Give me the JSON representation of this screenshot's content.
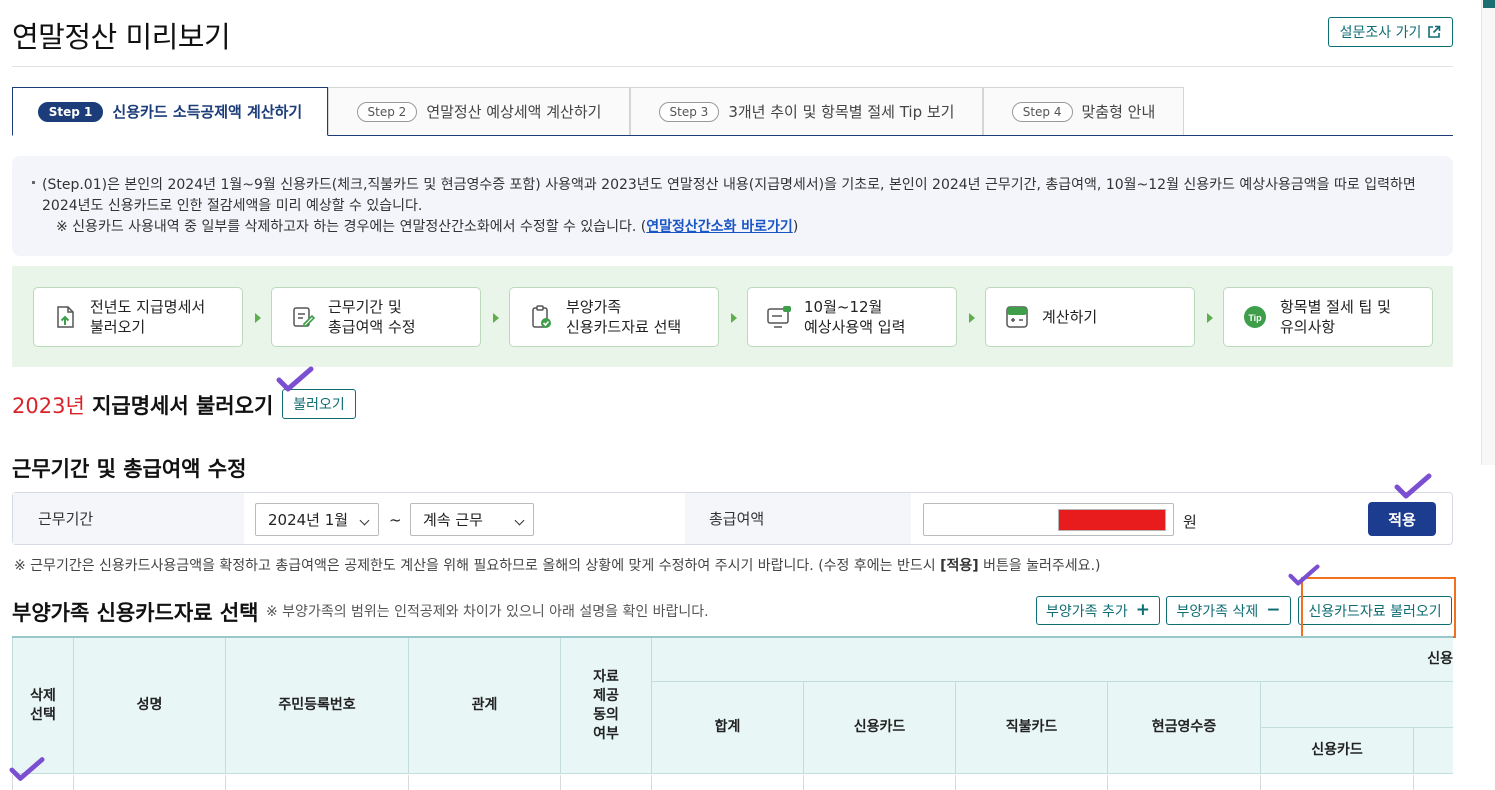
{
  "page": {
    "title": "연말정산 미리보기",
    "survey_button": "설문조사 가기"
  },
  "tabs": [
    {
      "step": "Step 1",
      "label": "신용카드 소득공제액 계산하기",
      "active": true
    },
    {
      "step": "Step 2",
      "label": "연말정산 예상세액 계산하기",
      "active": false
    },
    {
      "step": "Step 3",
      "label": "3개년 추이 및 항목별 절세 Tip 보기",
      "active": false
    },
    {
      "step": "Step 4",
      "label": "맞춤형 안내",
      "active": false
    }
  ],
  "notice": {
    "line1": "(Step.01)은 본인의 2024년 1월~9월 신용카드(체크,직불카드 및 현금영수증 포함) 사용액과 2023년도 연말정산 내용(지급명세서)을 기초로, 본인이 2024년 근무기간, 총급여액, 10월~12월 신용카드 예상사용금액을 따로 입력하면",
    "line2": "2024년도 신용카드로 인한 절감세액을 미리 예상할 수 있습니다.",
    "line3_prefix": "※ 신용카드 사용내역 중 일부를 삭제하고자 하는 경우에는 연말정산간소화에서 수정할 수 있습니다. (",
    "line3_link": "연말정산간소화 바로가기",
    "line3_suffix": ")"
  },
  "process": [
    {
      "icon": "document-upload-icon",
      "line1": "전년도 지급명세서",
      "line2": "불러오기"
    },
    {
      "icon": "edit-document-icon",
      "line1": "근무기간 및",
      "line2": "총급여액 수정"
    },
    {
      "icon": "clipboard-check-icon",
      "line1": "부양가족",
      "line2": "신용카드자료 선택"
    },
    {
      "icon": "card-input-icon",
      "line1": "10월~12월",
      "line2": "예상사용액 입력"
    },
    {
      "icon": "calculator-icon",
      "line1": "계산하기",
      "line2": ""
    },
    {
      "icon": "tip-icon",
      "line1": "항목별 절세 팁 및",
      "line2": "유의사항"
    }
  ],
  "section_2023": {
    "year": "2023년",
    "title": " 지급명세서 불러오기",
    "button": "불러오기"
  },
  "work": {
    "title": "근무기간 및 총급여액 수정",
    "period_label": "근무기간",
    "start_value": "2024년 1월",
    "tilde": "~",
    "end_value": "계속 근무",
    "salary_label": "총급여액",
    "unit": "원",
    "apply": "적용",
    "note_prefix": "※ 근무기간은 신용카드사용금액을 확정하고 총급여액은 공제한도 계산을 위해 필요하므로 올해의 상황에 맞게 수정하여 주시기 바랍니다. (수정 후에는 반드시 ",
    "note_bold": "[적용]",
    "note_suffix": " 버튼을 눌러주세요.)"
  },
  "dependents": {
    "title": "부양가족 신용카드자료 선택",
    "note": "※ 부양가족의 범위는 인적공제와 차이가 있으니 아래 설명을 확인 바랍니다.",
    "add": "부양가족 추가",
    "remove": "부양가족 삭제",
    "load_card": "신용카드자료 불러오기"
  },
  "table": {
    "headers": {
      "delete_select": "삭제\n선택",
      "name": "성명",
      "rrn": "주민등록번호",
      "relation": "관계",
      "consent": "자료\n제공\n동의\n여부",
      "group": "신용",
      "total": "합계",
      "credit": "신용카드",
      "debit": "직불카드",
      "cash": "현금영수증",
      "sub_credit": "신용카드"
    }
  },
  "colors": {
    "accent": "#1c3d7a",
    "teal": "#0f6d74",
    "red": "#d8232a",
    "highlight": "#f07120",
    "check": "#7b4fd1"
  }
}
